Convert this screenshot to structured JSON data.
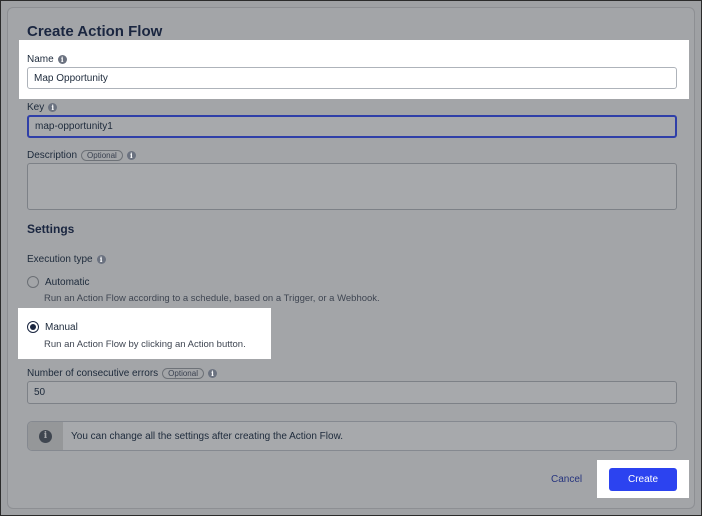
{
  "dialog": {
    "title": "Create Action Flow",
    "name": {
      "label": "Name",
      "value": "Map Opportunity"
    },
    "key": {
      "label": "Key",
      "value": "map-opportunity1"
    },
    "description": {
      "label": "Description",
      "optional": "Optional",
      "value": ""
    },
    "settings": {
      "heading": "Settings",
      "execution_type_label": "Execution type",
      "options": [
        {
          "label": "Automatic",
          "help": "Run an Action Flow according to a schedule, based on a Trigger, or a Webhook.",
          "checked": false
        },
        {
          "label": "Manual",
          "help": "Run an Action Flow by clicking an Action button.",
          "checked": true
        }
      ],
      "errors": {
        "label": "Number of consecutive errors",
        "optional": "Optional",
        "value": "50"
      }
    },
    "notice": "You can change all the settings after creating the Action Flow.",
    "buttons": {
      "cancel": "Cancel",
      "create": "Create"
    }
  },
  "icons": {
    "info": "info-icon",
    "notice": "info-circle-icon"
  },
  "colors": {
    "primary": "#2c43f0",
    "focus_border": "#2f3fa8",
    "overlay": "#9fa1a4"
  }
}
